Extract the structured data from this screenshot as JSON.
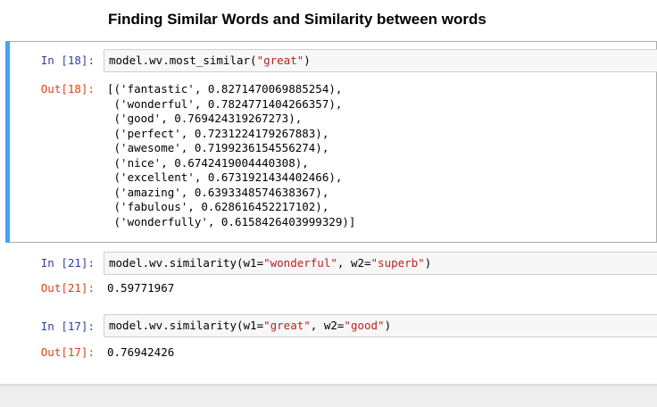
{
  "heading": "Finding Similar Words and Similarity between words",
  "cells": [
    {
      "in_prompt": "In [18]:",
      "code_prefix": "model.wv.most_similar(",
      "code_str1": "\"great\"",
      "code_suffix": ")",
      "out_prompt": "Out[18]:",
      "output_lines": [
        "[('fantastic', 0.8271470069885254),",
        " ('wonderful', 0.7824771404266357),",
        " ('good', 0.769424319267273),",
        " ('perfect', 0.7231224179267883),",
        " ('awesome', 0.7199236154556274),",
        " ('nice', 0.6742419004440308),",
        " ('excellent', 0.6731921434402466),",
        " ('amazing', 0.6393348574638367),",
        " ('fabulous', 0.628616452217102),",
        " ('wonderfully', 0.6158426403999329)]"
      ]
    },
    {
      "in_prompt": "In [21]:",
      "code_prefix": "model.wv.similarity(w1=",
      "code_str1": "\"wonderful\"",
      "code_mid": ", w2=",
      "code_str2": "\"superb\"",
      "code_suffix": ")",
      "out_prompt": "Out[21]:",
      "output_text": "0.59771967"
    },
    {
      "in_prompt": "In [17]:",
      "code_prefix": "model.wv.similarity(w1=",
      "code_str1": "\"great\"",
      "code_mid": ", w2=",
      "code_str2": "\"good\"",
      "code_suffix": ")",
      "out_prompt": "Out[17]:",
      "output_text": "0.76942426"
    }
  ],
  "colors": {
    "in_prompt": "#303f9f",
    "out_prompt": "#d84315",
    "string": "#ba2121",
    "selected_bar": "#42a5f5"
  }
}
